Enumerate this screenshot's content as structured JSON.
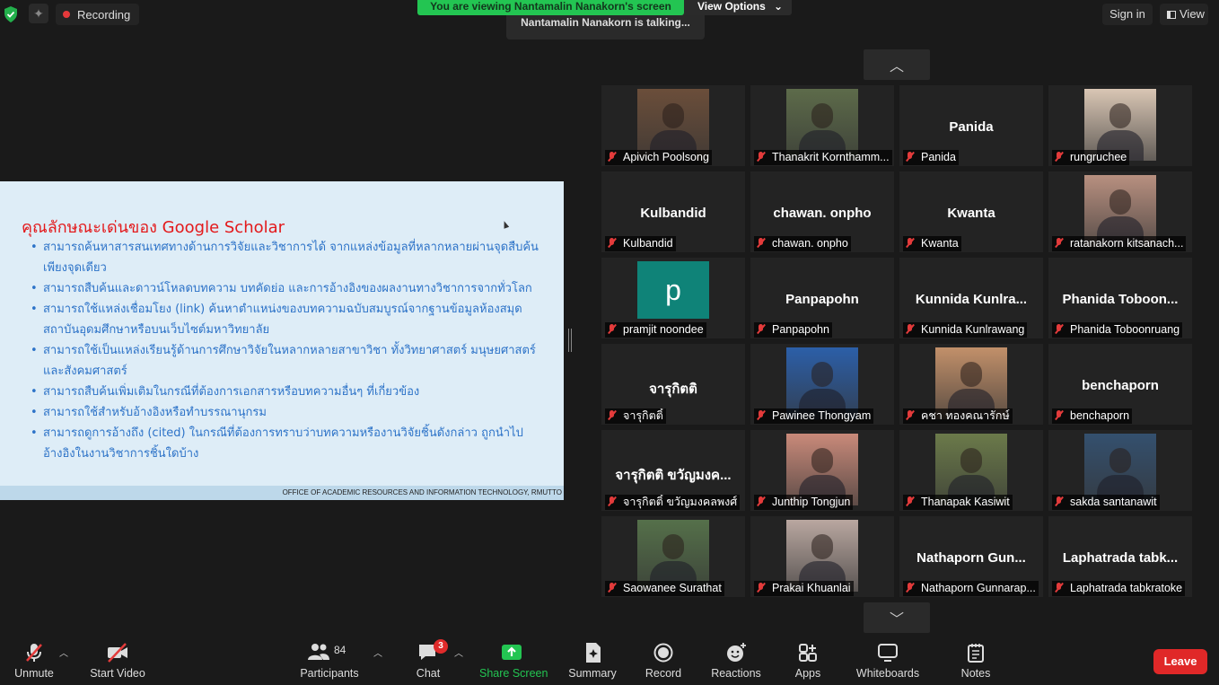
{
  "topbar": {
    "recording": "Recording",
    "viewing_banner": "You are viewing Nantamalin Nanakorn's screen",
    "view_options": "View Options",
    "talking": "Nantamalin Nanakorn is talking...",
    "sign_in": "Sign in",
    "view": "View"
  },
  "slide": {
    "title": "คุณลักษณะเด่นของ Google Scholar",
    "bullets": [
      "สามารถค้นหาสารสนเทศทางด้านการวิจัยและวิชาการได้ จากแหล่งข้อมูลที่หลากหลายผ่านจุดสืบค้นเพียงจุดเดียว",
      "สามารถสืบค้นและดาวน์โหลดบทความ บทคัดย่อ และการอ้างอิงของผลงานทางวิชาการจากทั่วโลก",
      "สามารถใช้แหล่งเชื่อมโยง (link) ค้นหาตำแหน่งของบทความฉบับสมบูรณ์จากฐานข้อมูลห้องสมุดสถาบันอุดมศึกษาหรือบนเว็บไซต์มหาวิทยาลัย",
      "สามารถใช้เป็นแหล่งเรียนรู้ด้านการศึกษาวิจัยในหลากหลายสาขาวิชา ทั้งวิทยาศาสตร์ มนุษยศาสตร์และสังคมศาสตร์",
      "สามารถสืบค้นเพิ่มเติมในกรณีที่ต้องการเอกสารหรือบทความอื่นๆ ที่เกี่ยวข้อง",
      "สามารถใช้สำหรับอ้างอิงหรือทำบรรณานุกรม",
      "สามารถดูการอ้างถึง (cited) ในกรณีที่ต้องการทราบว่าบทความหรืองานวิจัยชิ้นดังกล่าว ถูกนำไปอ้างอิงในงานวิชาการชิ้นใดบ้าง"
    ],
    "footer": "OFFICE OF ACADEMIC RESOURCES AND INFORMATION TECHNOLOGY, RMUTTO"
  },
  "participants": [
    {
      "label": "Apivich Poolsong",
      "bigname": "",
      "video": "#6b4e3a"
    },
    {
      "label": "Thanakrit Kornthamm...",
      "bigname": "",
      "video": "#5d6b4a"
    },
    {
      "label": "Panida",
      "bigname": "Panida",
      "video": ""
    },
    {
      "label": "rungruchee",
      "bigname": "",
      "video": "#d9c6b4"
    },
    {
      "label": "Kulbandid",
      "bigname": "Kulbandid",
      "video": ""
    },
    {
      "label": "chawan. onpho",
      "bigname": "chawan. onpho",
      "video": ""
    },
    {
      "label": "Kwanta",
      "bigname": "Kwanta",
      "video": ""
    },
    {
      "label": "ratanakorn kitsanach...",
      "bigname": "",
      "video": "#b89080"
    },
    {
      "label": "pramjit noondee",
      "bigname": "",
      "video": "letter",
      "letter": "p"
    },
    {
      "label": "Panpapohn",
      "bigname": "Panpapohn",
      "video": ""
    },
    {
      "label": "Kunnida Kunlrawang",
      "bigname": "Kunnida  Kunlra...",
      "video": ""
    },
    {
      "label": "Phanida Toboonruang",
      "bigname": "Phanida  Toboon...",
      "video": ""
    },
    {
      "label": "จารุกิตติ์",
      "bigname": "จารุกิตติ",
      "video": ""
    },
    {
      "label": "Pawinee Thongyam",
      "bigname": "",
      "video": "#2c5fa8"
    },
    {
      "label": "คชา ทองคณารักษ์",
      "bigname": "",
      "video": "#c2906a"
    },
    {
      "label": "benchaporn",
      "bigname": "benchaporn",
      "video": ""
    },
    {
      "label": "จารุกิตติ์ ขวัญมงคลพงศ์",
      "bigname": "จารุกิตติ ขวัญมงค...",
      "video": ""
    },
    {
      "label": "Junthip Tongjun",
      "bigname": "",
      "video": "#c98a7a"
    },
    {
      "label": "Thanapak Kasiwit",
      "bigname": "",
      "video": "#6b7a4a"
    },
    {
      "label": "sakda santanawit",
      "bigname": "",
      "video": "#34506e"
    },
    {
      "label": "Saowanee Surathat",
      "bigname": "",
      "video": "#55704a"
    },
    {
      "label": "Prakai Khuanlai",
      "bigname": "",
      "video": "#b9a7a0"
    },
    {
      "label": "Nathaporn Gunnarap...",
      "bigname": "Nathaporn  Gun...",
      "video": ""
    },
    {
      "label": "Laphatrada tabkratoke",
      "bigname": "Laphatrada  tabk...",
      "video": ""
    }
  ],
  "toolbar": {
    "unmute": "Unmute",
    "start_video": "Start Video",
    "participants": "Participants",
    "participants_count": "84",
    "chat": "Chat",
    "chat_badge": "3",
    "share_screen": "Share Screen",
    "summary": "Summary",
    "record": "Record",
    "reactions": "Reactions",
    "apps": "Apps",
    "whiteboards": "Whiteboards",
    "notes": "Notes",
    "leave": "Leave"
  },
  "colors": {
    "share_green": "#23c552",
    "leave_red": "#e02828",
    "slide_title": "#e3191b",
    "slide_text": "#2d73c8"
  }
}
